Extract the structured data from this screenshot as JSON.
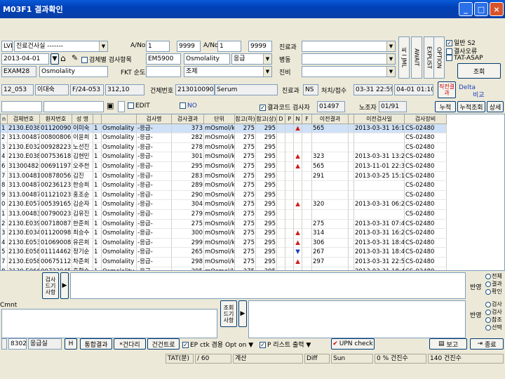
{
  "window": {
    "title": "M03F1 결과확인",
    "buttons": [
      "_",
      "□",
      "×"
    ]
  },
  "filters": {
    "lvl_label": "LVL",
    "lvl_value": "진료건사실 -------",
    "date_value": "2013-04-01",
    "exam_value": "EXAM28",
    "exam_name": "Osmolality",
    "chk_exam_label": "검체별 검사항목",
    "exam_code": "EM5900",
    "exam_code_name": "Osmolality",
    "exam_emergency": "응급",
    "fkt_label": "FKT 순도",
    "fkt_value": "조제",
    "ano_label": "A/No",
    "ano_from": "1",
    "ano_to": "9999",
    "ano2_label": "A/No",
    "ano2_from": "1",
    "ano2_to": "9999",
    "dept_label": "진료과",
    "ward_label": "병동",
    "room_label": "진비",
    "btn_v1": "씨 I JML",
    "btn_v2": "AWAIT",
    "btn_v3": "EXPLIST",
    "btn_v4": "OPTION",
    "chk_r1": "일반",
    "chk_r2": "결사오류",
    "chk_r3": "TAT-ASAP",
    "r1_note": "S2",
    "search_button": "조회"
  },
  "patient": {
    "id": "12_053",
    "name": "이대숙",
    "age": "F/24-053",
    "ward": "312,10",
    "reg_label": "건체번호",
    "reg_no": "2130100900",
    "specimen": "Serum",
    "dept_label": "진료과",
    "dept": "NS",
    "order_label": "처치/접수",
    "order_time": "03-31 22:59",
    "recv_time": "04-01 01:10",
    "prev_label": "직전결과",
    "delta_label": "Delta",
    "compare_label": "비교"
  },
  "toolbar2": {
    "edit_label": "EDIT",
    "no_label": "NO",
    "result_label": "결과코드 검사자",
    "result_code": "01497",
    "no2_label": "노조자",
    "no2_value": "01/91",
    "panel_label": "누적",
    "accum_label": "누적조회",
    "detail_label": "상세"
  },
  "grid": {
    "headers": [
      "n",
      "검체번호",
      "환자번호",
      "성 명",
      "",
      "",
      "검사명",
      "검사결과",
      "단위",
      "참고(하)",
      "참고(상)",
      "D",
      "P",
      "N",
      "F",
      "이전결과",
      "",
      "이전검사일",
      "검사장비"
    ],
    "rows": [
      [
        "1",
        "2130.E038",
        "01120090",
        "이미숙",
        "1",
        "Osmolality",
        "-응급-",
        "373",
        "mOsmol/kg",
        "275",
        "295",
        "",
        "",
        "▲",
        "",
        "565",
        "",
        "2013-03-31 16:1",
        "CS-02480"
      ],
      [
        "2",
        "313.0048738",
        "00800806",
        "이윤희",
        "1",
        "Osmolality",
        "-응급-",
        "282",
        "mOsmol/kg",
        "275",
        "295",
        "",
        "",
        "",
        "",
        "",
        "",
        "",
        "CS-02480"
      ],
      [
        "3",
        "2130.E0326",
        "00928223",
        "노선진",
        "1",
        "Osmolality",
        "-응급-",
        "278",
        "mOsmol/kg",
        "275",
        "295",
        "",
        "",
        "",
        "",
        "",
        "",
        "",
        "CS-02480"
      ],
      [
        "4",
        "2130.E038",
        "00753618",
        "김현민",
        "1",
        "Osmolality",
        "-응급-",
        "301",
        "mOsmol/kg",
        "275",
        "295",
        "",
        "",
        "▲",
        "",
        "323",
        "",
        "2013-03-31 13:27",
        "CS-02480"
      ],
      [
        "6",
        "3130048262",
        "00691197",
        "오주천",
        "1",
        "Osmolality",
        "-응급-",
        "295",
        "mOsmol/kg",
        "275",
        "295",
        "",
        "",
        "▲",
        "",
        "565",
        "",
        "2013-11-01 22:31",
        "CS-02480"
      ],
      [
        "7",
        "313.0048161",
        "00878056",
        "김진",
        "1",
        "Osmolality",
        "-응급-",
        "283",
        "mOsmol/kg",
        "275",
        "295",
        "",
        "",
        "",
        "",
        "291",
        "",
        "2013-03-25 15:18",
        "CS-02480"
      ],
      [
        "8",
        "313.0048767",
        "00236123",
        "한승희",
        "1",
        "Osmolality",
        "-응급-",
        "289",
        "mOsmol/kg",
        "275",
        "295",
        "",
        "",
        "",
        "",
        "",
        "",
        "",
        "CS-02480"
      ],
      [
        "9",
        "313.0048779",
        "01121023",
        "홍조순",
        "1",
        "Osmolality",
        "-응급-",
        "290",
        "mOsmol/kg",
        "275",
        "295",
        "",
        "",
        "",
        "",
        "",
        "",
        "",
        "CS-02480"
      ],
      [
        "0",
        "2130.E0571",
        "00539165",
        "김순자",
        "1",
        "Osmolality",
        "-응급-",
        "304",
        "mOsmol/kg",
        "275",
        "295",
        "",
        "",
        "▲",
        "",
        "320",
        "",
        "2013-03-31 06:29",
        "CS-02480"
      ],
      [
        "1",
        "313.0048387",
        "00790023",
        "김유진",
        "1",
        "Osmolality",
        "-응급-",
        "279",
        "mOsmol/kg",
        "275",
        "295",
        "",
        "",
        "",
        "",
        "",
        "",
        "",
        "CS-02480"
      ],
      [
        "2",
        "2130.E0395",
        "00718087",
        "한준희",
        "1",
        "Osmolality",
        "-응급-",
        "275",
        "mOsmol/kg",
        "275",
        "295",
        "",
        "",
        "",
        "",
        "275",
        "",
        "2013-03-31 07:41",
        "CS-02480"
      ],
      [
        "3",
        "2130.E0347",
        "01120098",
        "최승수",
        "1",
        "Osmolality",
        "-응급-",
        "300",
        "mOsmol/kg",
        "275",
        "295",
        "",
        "",
        "▲",
        "",
        "314",
        "",
        "2013-03-31 16:27",
        "CS-02480"
      ],
      [
        "4",
        "2130.E0535",
        "01069008",
        "유은희",
        "1",
        "Osmolality",
        "-응급-",
        "299",
        "mOsmol/kg",
        "275",
        "295",
        "",
        "",
        "▲",
        "",
        "306",
        "",
        "2013-03-31 18:47",
        "CS-02480"
      ],
      [
        "5",
        "2130.E0587",
        "01114462",
        "정기순",
        "1",
        "Osmolality",
        "-응급-",
        "265",
        "mOsmol/kg",
        "275",
        "295",
        "",
        "",
        "▼",
        "",
        "267",
        "",
        "2013-03-31 18:47",
        "CS-02480"
      ],
      [
        "7",
        "2130.E0586",
        "00675112",
        "차준희",
        "1",
        "Osmolality",
        "-응급-",
        "298",
        "mOsmol/kg",
        "275",
        "295",
        "",
        "",
        "▲",
        "",
        "297",
        "",
        "2013-03-31 22:55",
        "CS-02480"
      ],
      [
        "8",
        "2130.E0660",
        "00723045",
        "홍향순",
        "1",
        "Osmolality",
        "-응급-",
        "295",
        "mOsmol/kg",
        "275",
        "295",
        "",
        "",
        "",
        "",
        "",
        "",
        "2013-03-31 18:45",
        "CS-02480"
      ]
    ]
  },
  "comments": {
    "label1": "검사 드기 사항",
    "label2": "Cmnt",
    "label3": "조회 드기 사항",
    "right1_label": "반영",
    "right2_label": "반영",
    "radio1": [
      "전체",
      "결과",
      "확인"
    ],
    "radio2": [
      "검사",
      "검사",
      "참조",
      "선택"
    ]
  },
  "bottom": {
    "code": "83020",
    "dept": "응급실",
    "h_label": "H",
    "btn1": "통합결과",
    "btn2": "*건다리",
    "btn3": "건건트로",
    "chk1": "EP ctk 겸용 Opt on",
    "chk2": "P 리스트 출력",
    "btn_upn": "UPN check",
    "btn_print": "보고",
    "btn_exit": "종료"
  },
  "statusbar": {
    "s1": "TAT(분)",
    "s2": "/ 60",
    "s3": "계산",
    "s4": "Diff",
    "s5": "Sun",
    "s6": "0 % 건진수",
    "s7": "140 건진수"
  }
}
